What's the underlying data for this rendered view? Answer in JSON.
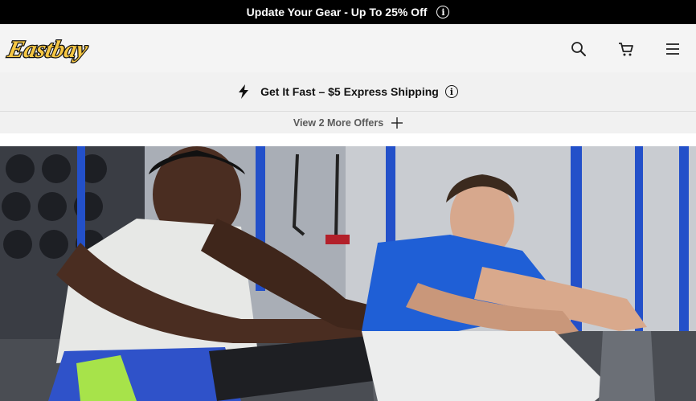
{
  "promo": {
    "text": "Update Your Gear - Up To 25% Off",
    "info_icon": "info-icon"
  },
  "header": {
    "logo_text": "Eastbay",
    "icons": [
      "search-icon",
      "cart-icon",
      "menu-icon"
    ]
  },
  "offers": {
    "main_text": "Get It Fast – $5 Express Shipping",
    "more_label": "View 2 More Offers"
  },
  "colors": {
    "promo_bg": "#000000",
    "header_bg": "#f4f4f4",
    "logo_yellow": "#f6c744",
    "shirt_blue": "#1f5fd6"
  }
}
